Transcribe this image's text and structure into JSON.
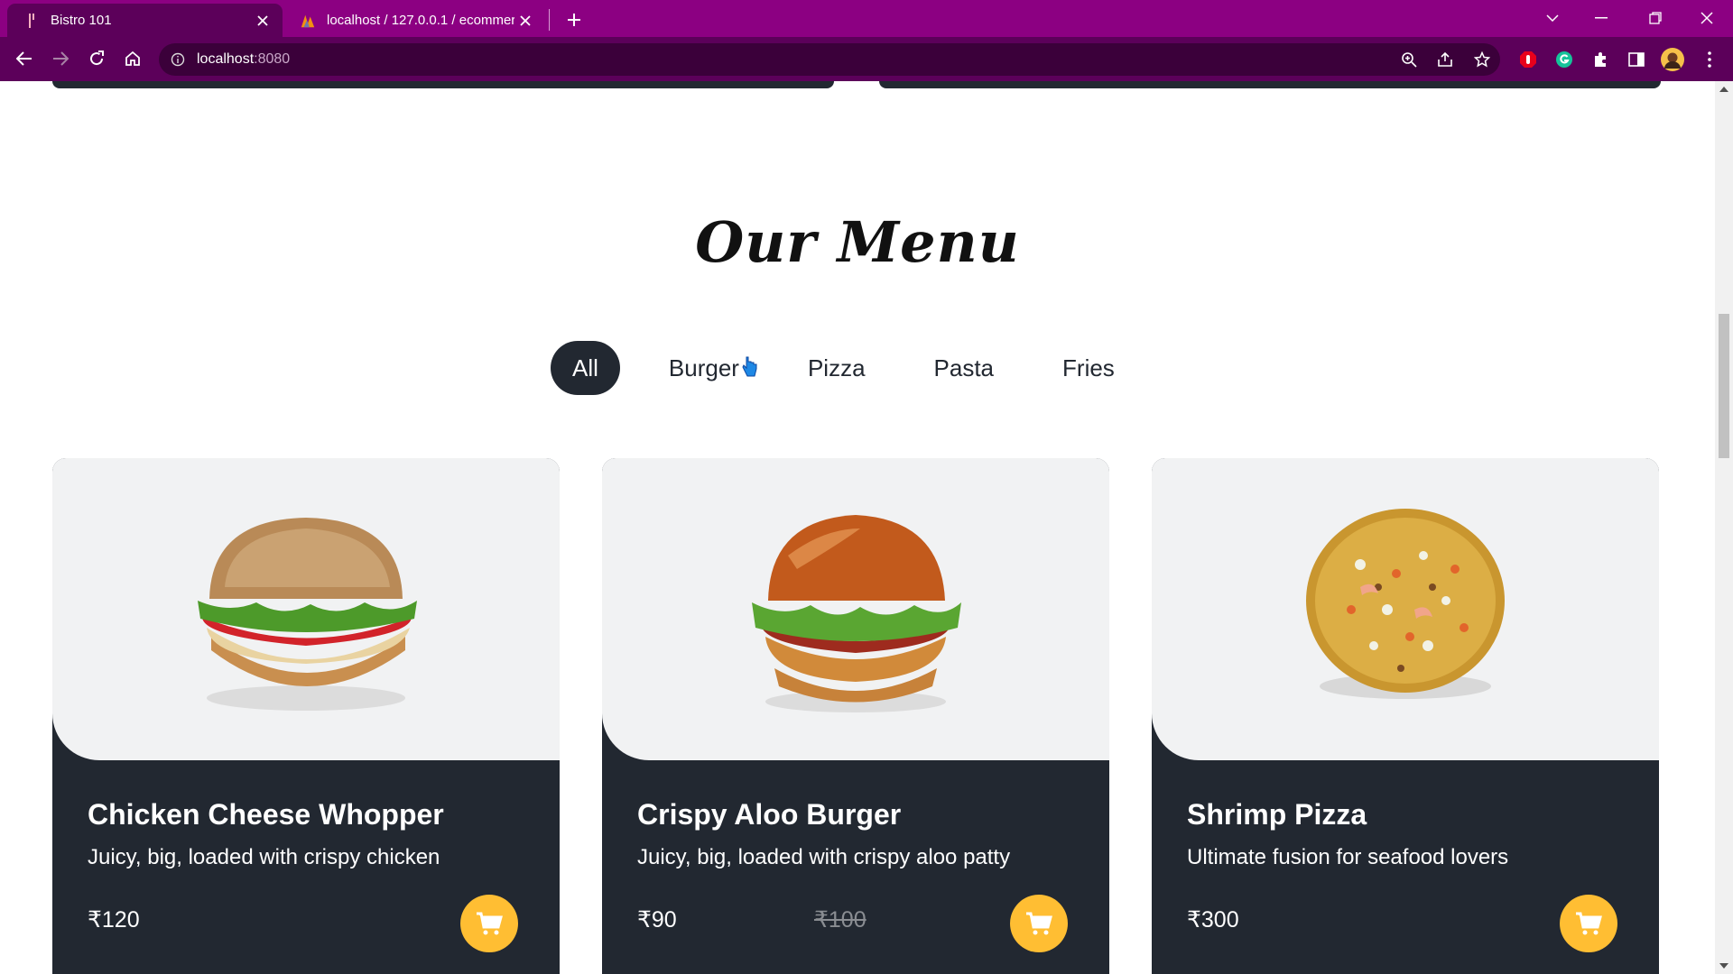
{
  "browser": {
    "tabs": [
      {
        "title": "Bistro 101",
        "active": true
      },
      {
        "title": "localhost / 127.0.0.1 / ecommerc",
        "active": false
      }
    ],
    "address": {
      "host": "localhost",
      "port": ":8080"
    },
    "frame_color": "#8c0082"
  },
  "page": {
    "heading": "Our Menu",
    "filters": [
      "All",
      "Burger",
      "Pizza",
      "Pasta",
      "Fries"
    ],
    "active_filter": "All",
    "accent_color": "#ffbe33",
    "dark_color": "#222831",
    "products": [
      {
        "name": "Chicken Cheese Whopper",
        "description": "Juicy, big, loaded with crispy chicken",
        "price": "₹120",
        "old_price": "",
        "image": "burger-chicken-image"
      },
      {
        "name": "Crispy Aloo Burger",
        "description": "Juicy, big, loaded with crispy aloo patty",
        "price": "₹90",
        "old_price": "₹100",
        "image": "burger-aloo-image"
      },
      {
        "name": "Shrimp Pizza",
        "description": "Ultimate fusion for seafood lovers",
        "price": "₹300",
        "old_price": "",
        "image": "pizza-shrimp-image"
      }
    ]
  }
}
